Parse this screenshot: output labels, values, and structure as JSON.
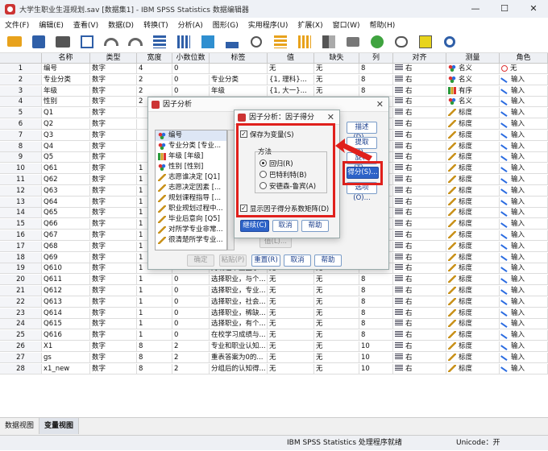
{
  "window": {
    "title": "大学生职业生涯规划.sav [数据集1] - IBM SPSS Statistics 数据编辑器",
    "minimize": "—",
    "maximize": "☐",
    "close": "✕"
  },
  "menu": [
    "文件(F)",
    "编辑(E)",
    "查看(V)",
    "数据(D)",
    "转换(T)",
    "分析(A)",
    "图形(G)",
    "实用程序(U)",
    "扩展(X)",
    "窗口(W)",
    "帮助(H)"
  ],
  "toolbar_icons": [
    "open-folder-icon",
    "save-icon",
    "print-icon",
    "dialog-recall-icon",
    "undo-icon",
    "redo-icon",
    "goto-case-icon",
    "goto-variable-icon",
    "variables-icon",
    "run-descriptive-icon",
    "find-icon",
    "insert-cases-icon",
    "insert-variable-icon",
    "split-file-icon",
    "weight-cases-icon",
    "select-cases-icon",
    "value-labels-icon",
    "use-sets-icon",
    "search-icon"
  ],
  "columns": [
    "名称",
    "类型",
    "宽度",
    "小数位数",
    "标签",
    "值",
    "缺失",
    "列",
    "对齐",
    "测量",
    "角色"
  ],
  "rows": [
    {
      "n": "1",
      "name": "编号",
      "type": "数字",
      "width": "4",
      "dec": "0",
      "label": "",
      "values": "无",
      "missing": "无",
      "col": "8",
      "align": "右",
      "measure": "名义",
      "mtype": "nominal",
      "role": "无",
      "rtype": "none"
    },
    {
      "n": "2",
      "name": "专业分类",
      "type": "数字",
      "width": "2",
      "dec": "0",
      "label": "专业分类",
      "values": "{1, 理科}...",
      "missing": "无",
      "col": "8",
      "align": "右",
      "measure": "名义",
      "mtype": "nominal",
      "role": "输入",
      "rtype": "input"
    },
    {
      "n": "3",
      "name": "年级",
      "type": "数字",
      "width": "2",
      "dec": "0",
      "label": "年级",
      "values": "{1, 大一}...",
      "missing": "无",
      "col": "8",
      "align": "右",
      "measure": "有序",
      "mtype": "ordinal",
      "role": "输入",
      "rtype": "input"
    },
    {
      "n": "4",
      "name": "性别",
      "type": "数字",
      "width": "2",
      "dec": "0",
      "label": "性别",
      "values": "{1, 男}...",
      "missing": "无",
      "col": "8",
      "align": "右",
      "measure": "名义",
      "mtype": "nominal",
      "role": "输入",
      "rtype": "input"
    },
    {
      "n": "5",
      "name": "Q1",
      "type": "数字",
      "width": "",
      "dec": "",
      "label": "",
      "values": "",
      "missing": "",
      "col": "",
      "align": "右",
      "measure": "标度",
      "mtype": "scale",
      "role": "输入",
      "rtype": "input"
    },
    {
      "n": "6",
      "name": "Q2",
      "type": "数字",
      "width": "",
      "dec": "",
      "label": "",
      "values": "",
      "missing": "",
      "col": "",
      "align": "右",
      "measure": "标度",
      "mtype": "scale",
      "role": "输入",
      "rtype": "input"
    },
    {
      "n": "7",
      "name": "Q3",
      "type": "数字",
      "width": "",
      "dec": "",
      "label": "",
      "values": "",
      "missing": "",
      "col": "",
      "align": "右",
      "measure": "标度",
      "mtype": "scale",
      "role": "输入",
      "rtype": "input"
    },
    {
      "n": "8",
      "name": "Q4",
      "type": "数字",
      "width": "",
      "dec": "",
      "label": "",
      "values": "",
      "missing": "",
      "col": "",
      "align": "右",
      "measure": "标度",
      "mtype": "scale",
      "role": "输入",
      "rtype": "input"
    },
    {
      "n": "9",
      "name": "Q5",
      "type": "数字",
      "width": "",
      "dec": "",
      "label": "",
      "values": "",
      "missing": "",
      "col": "",
      "align": "右",
      "measure": "标度",
      "mtype": "scale",
      "role": "输入",
      "rtype": "input"
    },
    {
      "n": "10",
      "name": "Q61",
      "type": "数字",
      "width": "1",
      "dec": "",
      "label": "",
      "values": "",
      "missing": "",
      "col": "",
      "align": "右",
      "measure": "标度",
      "mtype": "scale",
      "role": "输入",
      "rtype": "input"
    },
    {
      "n": "11",
      "name": "Q62",
      "type": "数字",
      "width": "1",
      "dec": "",
      "label": "",
      "values": "",
      "missing": "",
      "col": "",
      "align": "右",
      "measure": "标度",
      "mtype": "scale",
      "role": "输入",
      "rtype": "input"
    },
    {
      "n": "12",
      "name": "Q63",
      "type": "数字",
      "width": "1",
      "dec": "",
      "label": "",
      "values": "",
      "missing": "",
      "col": "",
      "align": "右",
      "measure": "标度",
      "mtype": "scale",
      "role": "输入",
      "rtype": "input"
    },
    {
      "n": "13",
      "name": "Q64",
      "type": "数字",
      "width": "1",
      "dec": "",
      "label": "",
      "values": "",
      "missing": "",
      "col": "",
      "align": "右",
      "measure": "标度",
      "mtype": "scale",
      "role": "输入",
      "rtype": "input"
    },
    {
      "n": "14",
      "name": "Q65",
      "type": "数字",
      "width": "1",
      "dec": "",
      "label": "",
      "values": "",
      "missing": "",
      "col": "",
      "align": "右",
      "measure": "标度",
      "mtype": "scale",
      "role": "输入",
      "rtype": "input"
    },
    {
      "n": "15",
      "name": "Q66",
      "type": "数字",
      "width": "1",
      "dec": "",
      "label": "",
      "values": "",
      "missing": "",
      "col": "",
      "align": "右",
      "measure": "标度",
      "mtype": "scale",
      "role": "输入",
      "rtype": "input"
    },
    {
      "n": "16",
      "name": "Q67",
      "type": "数字",
      "width": "1",
      "dec": "",
      "label": "",
      "values": "",
      "missing": "",
      "col": "",
      "align": "右",
      "measure": "标度",
      "mtype": "scale",
      "role": "输入",
      "rtype": "input"
    },
    {
      "n": "17",
      "name": "Q68",
      "type": "数字",
      "width": "1",
      "dec": "",
      "label": "",
      "values": "",
      "missing": "",
      "col": "",
      "align": "右",
      "measure": "标度",
      "mtype": "scale",
      "role": "输入",
      "rtype": "input"
    },
    {
      "n": "18",
      "name": "Q69",
      "type": "数字",
      "width": "1",
      "dec": "",
      "label": "",
      "values": "",
      "missing": "",
      "col": "",
      "align": "右",
      "measure": "标度",
      "mtype": "scale",
      "role": "输入",
      "rtype": "input"
    },
    {
      "n": "19",
      "name": "Q610",
      "type": "数字",
      "width": "1",
      "dec": "0",
      "label": "对现在毕业生求...",
      "values": "无",
      "missing": "无",
      "col": "8",
      "align": "右",
      "measure": "标度",
      "mtype": "scale",
      "role": "输入",
      "rtype": "input"
    },
    {
      "n": "20",
      "name": "Q611",
      "type": "数字",
      "width": "1",
      "dec": "0",
      "label": "选择职业，与个...",
      "values": "无",
      "missing": "无",
      "col": "8",
      "align": "右",
      "measure": "标度",
      "mtype": "scale",
      "role": "输入",
      "rtype": "input"
    },
    {
      "n": "21",
      "name": "Q612",
      "type": "数字",
      "width": "1",
      "dec": "0",
      "label": "选择职业，专业...",
      "values": "无",
      "missing": "无",
      "col": "8",
      "align": "右",
      "measure": "标度",
      "mtype": "scale",
      "role": "输入",
      "rtype": "input"
    },
    {
      "n": "22",
      "name": "Q613",
      "type": "数字",
      "width": "1",
      "dec": "0",
      "label": "选择职业，社会...",
      "values": "无",
      "missing": "无",
      "col": "8",
      "align": "右",
      "measure": "标度",
      "mtype": "scale",
      "role": "输入",
      "rtype": "input"
    },
    {
      "n": "23",
      "name": "Q614",
      "type": "数字",
      "width": "1",
      "dec": "0",
      "label": "选择职业，稀缺...",
      "values": "无",
      "missing": "无",
      "col": "8",
      "align": "右",
      "measure": "标度",
      "mtype": "scale",
      "role": "输入",
      "rtype": "input"
    },
    {
      "n": "24",
      "name": "Q615",
      "type": "数字",
      "width": "1",
      "dec": "0",
      "label": "选择职业，有个...",
      "values": "无",
      "missing": "无",
      "col": "8",
      "align": "右",
      "measure": "标度",
      "mtype": "scale",
      "role": "输入",
      "rtype": "input"
    },
    {
      "n": "25",
      "name": "Q616",
      "type": "数字",
      "width": "1",
      "dec": "0",
      "label": "在校学习成绩与...",
      "values": "无",
      "missing": "无",
      "col": "8",
      "align": "右",
      "measure": "标度",
      "mtype": "scale",
      "role": "输入",
      "rtype": "input"
    },
    {
      "n": "26",
      "name": "X1",
      "type": "数字",
      "width": "8",
      "dec": "2",
      "label": "专业和职业认知...",
      "values": "无",
      "missing": "无",
      "col": "10",
      "align": "右",
      "measure": "标度",
      "mtype": "scale",
      "role": "输入",
      "rtype": "input"
    },
    {
      "n": "27",
      "name": "gs",
      "type": "数字",
      "width": "8",
      "dec": "2",
      "label": "重表答案为0的...",
      "values": "无",
      "missing": "无",
      "col": "10",
      "align": "右",
      "measure": "标度",
      "mtype": "scale",
      "role": "输入",
      "rtype": "input"
    },
    {
      "n": "28",
      "name": "x1_new",
      "type": "数字",
      "width": "8",
      "dec": "2",
      "label": "分组后的认知得...",
      "values": "无",
      "missing": "无",
      "col": "10",
      "align": "右",
      "measure": "标度",
      "mtype": "scale",
      "role": "输入",
      "rtype": "input"
    }
  ],
  "factor_dialog": {
    "title": "因子分析",
    "close": "✕",
    "variables": [
      {
        "label": "编号",
        "icon": "nominal"
      },
      {
        "label": "专业分类 [专业...",
        "icon": "nominal"
      },
      {
        "label": "年级 [年级]",
        "icon": "ordinal"
      },
      {
        "label": "性别 [性别]",
        "icon": "nominal"
      },
      {
        "label": "志愿谁决定 [Q1]",
        "icon": "ruler"
      },
      {
        "label": "志愿决定因素 [...",
        "icon": "ruler"
      },
      {
        "label": "规划课程指导 [...",
        "icon": "ruler"
      },
      {
        "label": "职业规划过程中...",
        "icon": "ruler"
      },
      {
        "label": "毕业后意向 [Q5]",
        "icon": "ruler"
      },
      {
        "label": "对所学专业非常...",
        "icon": "ruler"
      },
      {
        "label": "很清楚所学专业...",
        "icon": "ruler"
      }
    ],
    "side_buttons": [
      "描述(D)...",
      "提取(E)...",
      "旋转(T)...",
      "得分(S)...",
      "选项(O)..."
    ],
    "value_button": "值(L)...",
    "bottom_buttons": [
      "确定",
      "粘贴(P)",
      "重置(R)",
      "取消",
      "帮助"
    ]
  },
  "score_dialog": {
    "title": "因子分析：因子得分",
    "close": "✕",
    "save_as_variables": "保存为变量(S)",
    "method_label": "方法",
    "methods": [
      "回归(R)",
      "巴特利特(B)",
      "安德森-鲁宾(A)"
    ],
    "selected_method": "回归(R)",
    "show_matrix": "显示因子得分系数矩阵(D)",
    "buttons": [
      "继续(C)",
      "取消",
      "帮助"
    ]
  },
  "tabs": [
    "数据视图",
    "变量视图"
  ],
  "active_tab": "变量视图",
  "status": {
    "processor": "IBM SPSS Statistics 处理程序就绪",
    "unicode": "Unicode：开"
  },
  "colors": {
    "accent": "#2d63c8",
    "highlight": "#e0201c"
  }
}
